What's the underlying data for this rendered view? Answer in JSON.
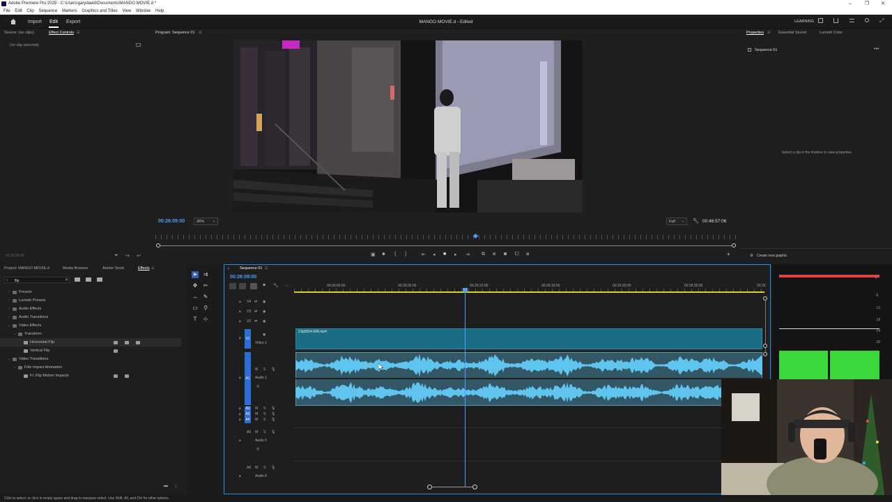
{
  "window": {
    "title": "Adobe Premiere Pro 2025 - C:\\Users\\garydavid\\Documents\\MANGO MOVIE.d *",
    "controls": [
      "–",
      "❐",
      "✕"
    ]
  },
  "menu": [
    "File",
    "Edit",
    "Clip",
    "Sequence",
    "Markers",
    "Graphics and Titles",
    "View",
    "Window",
    "Help"
  ],
  "appbar": {
    "nav": [
      "Import",
      "Edit",
      "Export"
    ],
    "active_nav": "Edit",
    "project_title": "MANGO MOVIE.d - Edited",
    "workspace": "LEARNING"
  },
  "source_panel": {
    "tabs": [
      "Source: (no clips)",
      "Effect Controls"
    ],
    "message": "(no clip selected)",
    "timecode": "00:26:09:00"
  },
  "program_monitor": {
    "tab": "Program: Sequence 01",
    "timecode": "00:26:09:00",
    "zoom": "26%",
    "resolution": "Full",
    "duration": "00:46:57:06",
    "playhead_fraction": 0.55
  },
  "properties_panel": {
    "tabs": [
      "Properties",
      "Essential Sound",
      "Lumetri Color"
    ],
    "sequence": "Sequence 01",
    "message": "Select a clip in the timeline to view properties.",
    "create_graphic": "Create new graphic"
  },
  "project_panel": {
    "tabs": [
      "Project: MANGO MOVIE.d",
      "Media Browser",
      "Adobe Stock",
      "Effects"
    ],
    "search_value": "flip",
    "tree": [
      {
        "label": "Presets",
        "level": 0,
        "open": false
      },
      {
        "label": "Lumetri Presets",
        "level": 0,
        "open": false
      },
      {
        "label": "Audio Effects",
        "level": 0,
        "open": false
      },
      {
        "label": "Audio Transitions",
        "level": 0,
        "open": false
      },
      {
        "label": "Video Effects",
        "level": 0,
        "open": true
      },
      {
        "label": "Transform",
        "level": 1,
        "open": true
      },
      {
        "label": "Horizontal Flip",
        "level": 2,
        "item": true,
        "selected": true
      },
      {
        "label": "Vertical Flip",
        "level": 2,
        "item": true
      },
      {
        "label": "Video Transitions",
        "level": 0,
        "open": true
      },
      {
        "label": "Film Impact Animation",
        "level": 1,
        "open": true
      },
      {
        "label": "FI: Flip Motion Impacts",
        "level": 2,
        "item": true
      }
    ]
  },
  "timeline": {
    "tab": "Sequence 01",
    "timecode": "00:26:09:00",
    "ruler": [
      "00:26:00:00",
      "00:26:05:00",
      "00:26:10:00",
      "00:26:15:00",
      "00:26:20:00",
      "00:26:25:00",
      "00:26"
    ],
    "tracks": {
      "v4": "V4",
      "v3": "V3",
      "v2": "V2",
      "v1": "V1",
      "video1": "Video 1",
      "a1": "A1",
      "audio1": "Audio 1",
      "a2": "A2",
      "a3": "A3",
      "a4": "A4",
      "a5": "A5",
      "audio5": "Audio 5",
      "a6": "A6",
      "audio6": "Audio 6"
    },
    "clip_name": "Clip0054-008.mp4"
  },
  "meter": {
    "ticks": [
      "0",
      "-6",
      "-12",
      "-18",
      "-24",
      "-30"
    ],
    "labels": [
      "S",
      "S"
    ]
  },
  "status": "Click to select, or click in empty space and drag to marquee select. Use Shift, Alt, and Ctrl for other options.",
  "colors": {
    "accent": "#2d8ceb",
    "clip_video": "#1b6d86",
    "clip_audio": "#5fc4ee",
    "meter_green": "#3ad83a",
    "meter_red": "#e04343"
  }
}
